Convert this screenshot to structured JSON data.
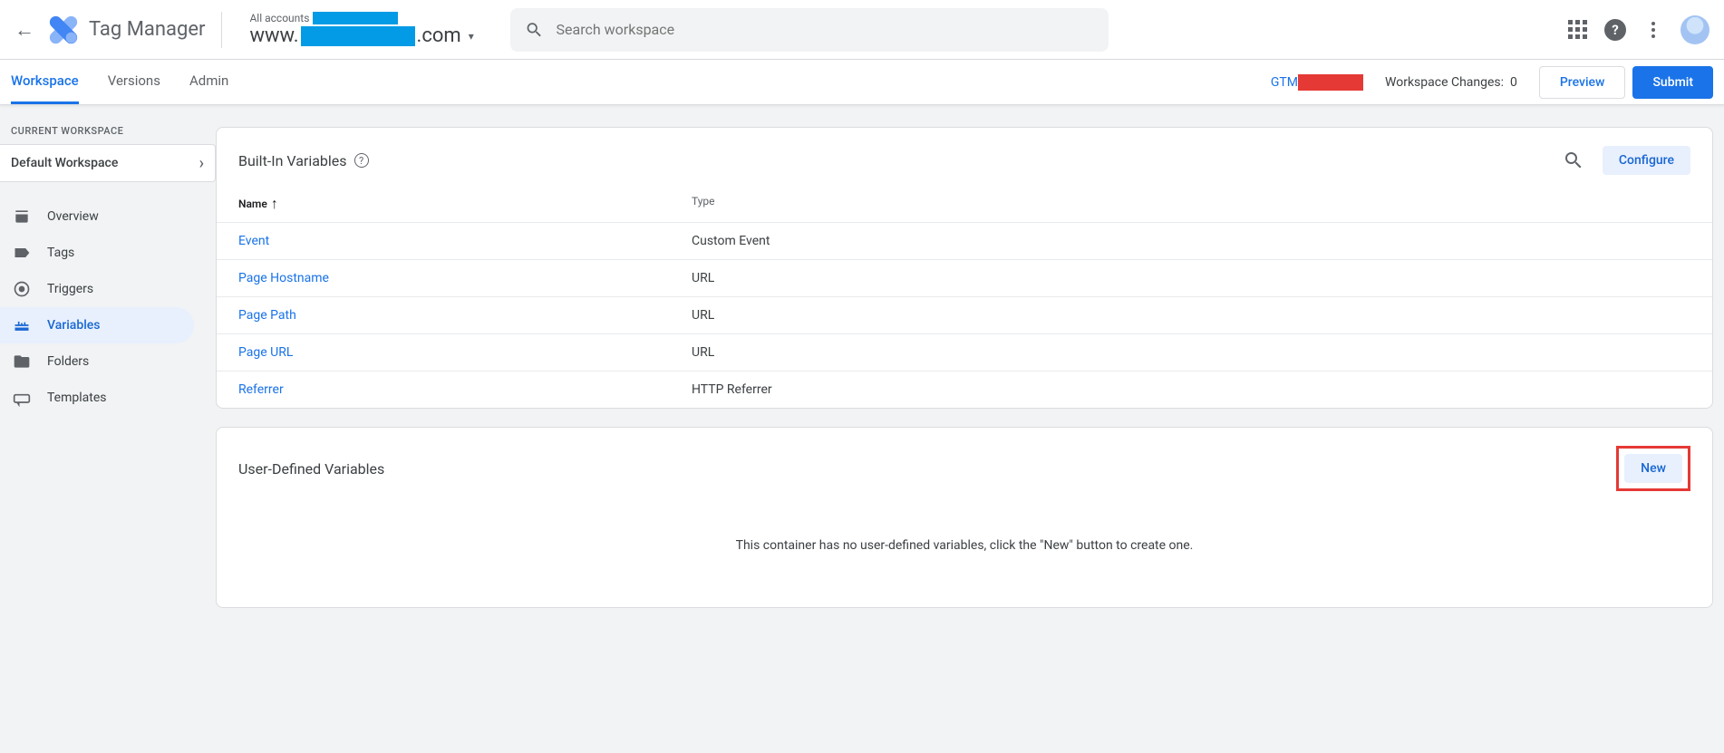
{
  "header": {
    "app_title": "Tag Manager",
    "all_accounts": "All accounts",
    "domain_prefix": "www.",
    "domain_suffix": ".com",
    "search_placeholder": "Search workspace"
  },
  "subnav": {
    "tabs": {
      "workspace": "Workspace",
      "versions": "Versions",
      "admin": "Admin"
    },
    "container_prefix": "GTM",
    "changes_label": "Workspace Changes:",
    "changes_count": "0",
    "preview": "Preview",
    "submit": "Submit"
  },
  "sidebar": {
    "current_ws_label": "CURRENT WORKSPACE",
    "ws_name": "Default Workspace",
    "items": {
      "overview": "Overview",
      "tags": "Tags",
      "triggers": "Triggers",
      "variables": "Variables",
      "folders": "Folders",
      "templates": "Templates"
    }
  },
  "builtin": {
    "title": "Built-In Variables",
    "configure": "Configure",
    "col_name": "Name",
    "col_type": "Type",
    "rows": [
      {
        "name": "Event",
        "type": "Custom Event"
      },
      {
        "name": "Page Hostname",
        "type": "URL"
      },
      {
        "name": "Page Path",
        "type": "URL"
      },
      {
        "name": "Page URL",
        "type": "URL"
      },
      {
        "name": "Referrer",
        "type": "HTTP Referrer"
      }
    ]
  },
  "userdef": {
    "title": "User-Defined Variables",
    "new": "New",
    "empty": "This container has no user-defined variables, click the \"New\" button to create one."
  }
}
